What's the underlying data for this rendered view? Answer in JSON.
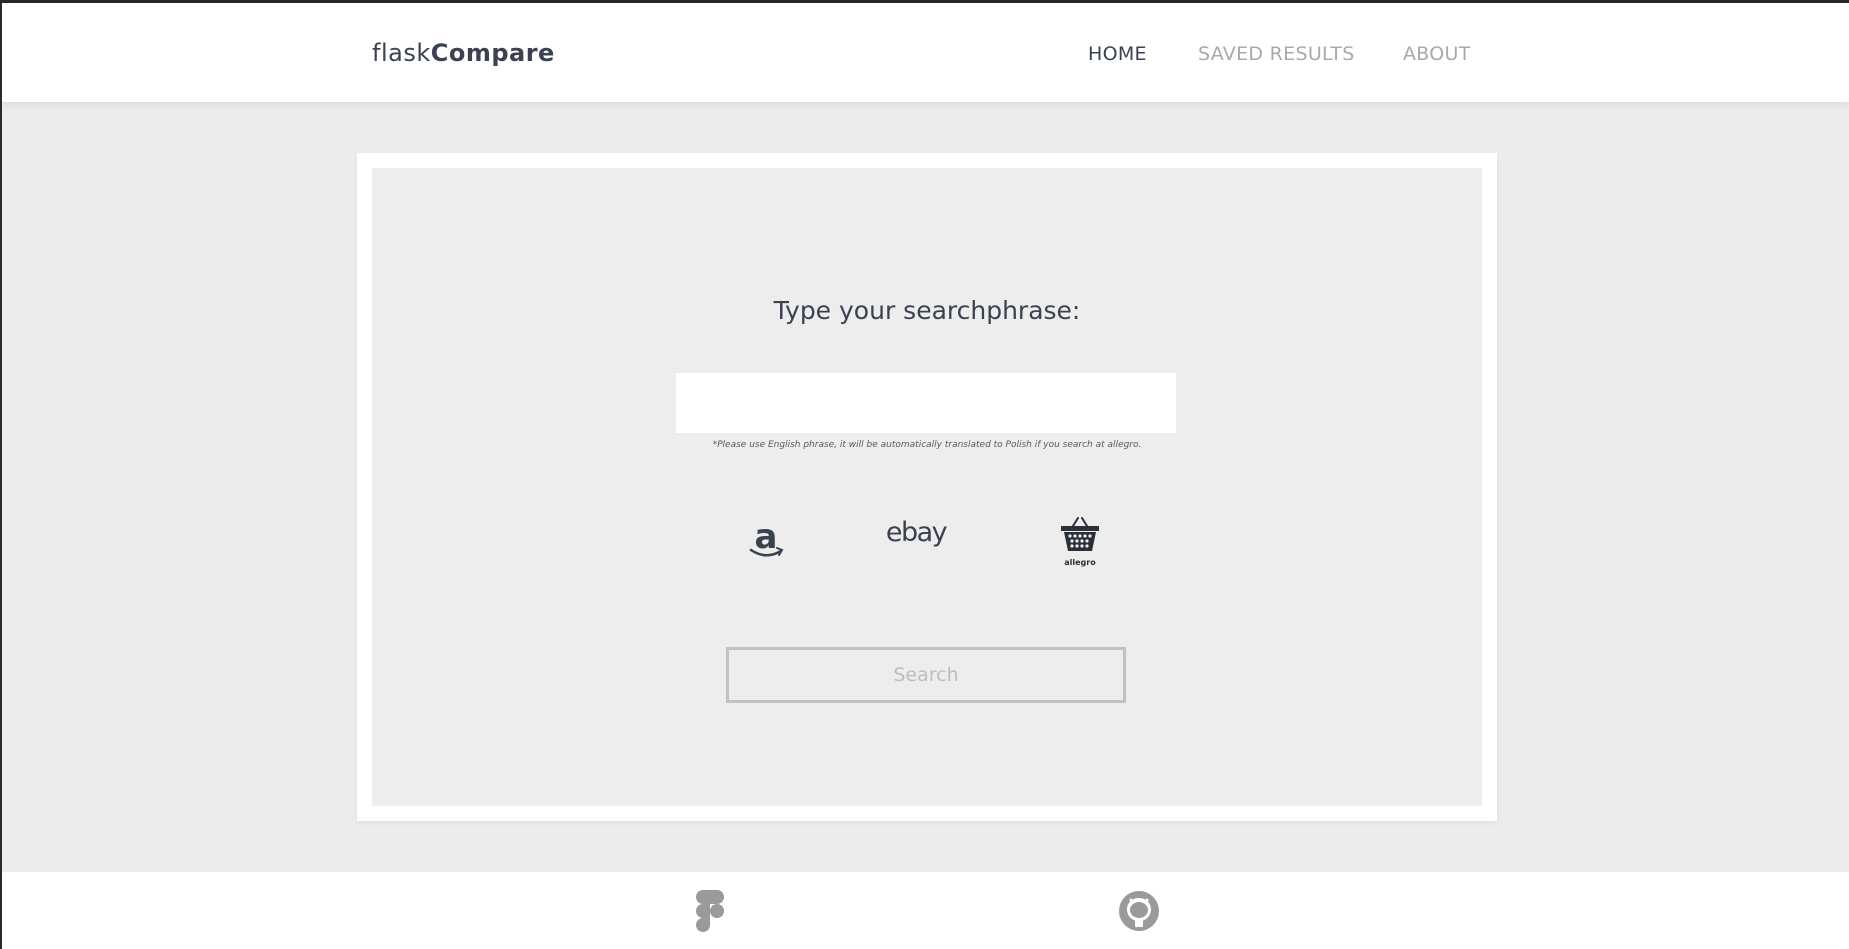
{
  "header": {
    "logo_light": "flask",
    "logo_bold": "Compare",
    "nav": {
      "home": "HOME",
      "saved": "SAVED RESULTS",
      "about": "ABOUT"
    }
  },
  "main": {
    "heading": "Type your searchphrase:",
    "search": {
      "value": "",
      "placeholder": ""
    },
    "note": "*Please use English phrase, it will be automatically translated to Polish if you search at allegro.",
    "stores": {
      "amazon_icon": "amazon-logo",
      "ebay_icon": "ebay-logo",
      "allegro_icon": "allegro-basket-logo",
      "allegro_label": "allegro"
    },
    "search_button": "Search"
  },
  "footer": {
    "icons": [
      "figma-icon",
      "github-icon"
    ]
  },
  "colors": {
    "page_bg": "#ececec",
    "text_dark": "#3a4150",
    "nav_muted": "#a6a9ae",
    "button_border": "#c2c2c2"
  }
}
